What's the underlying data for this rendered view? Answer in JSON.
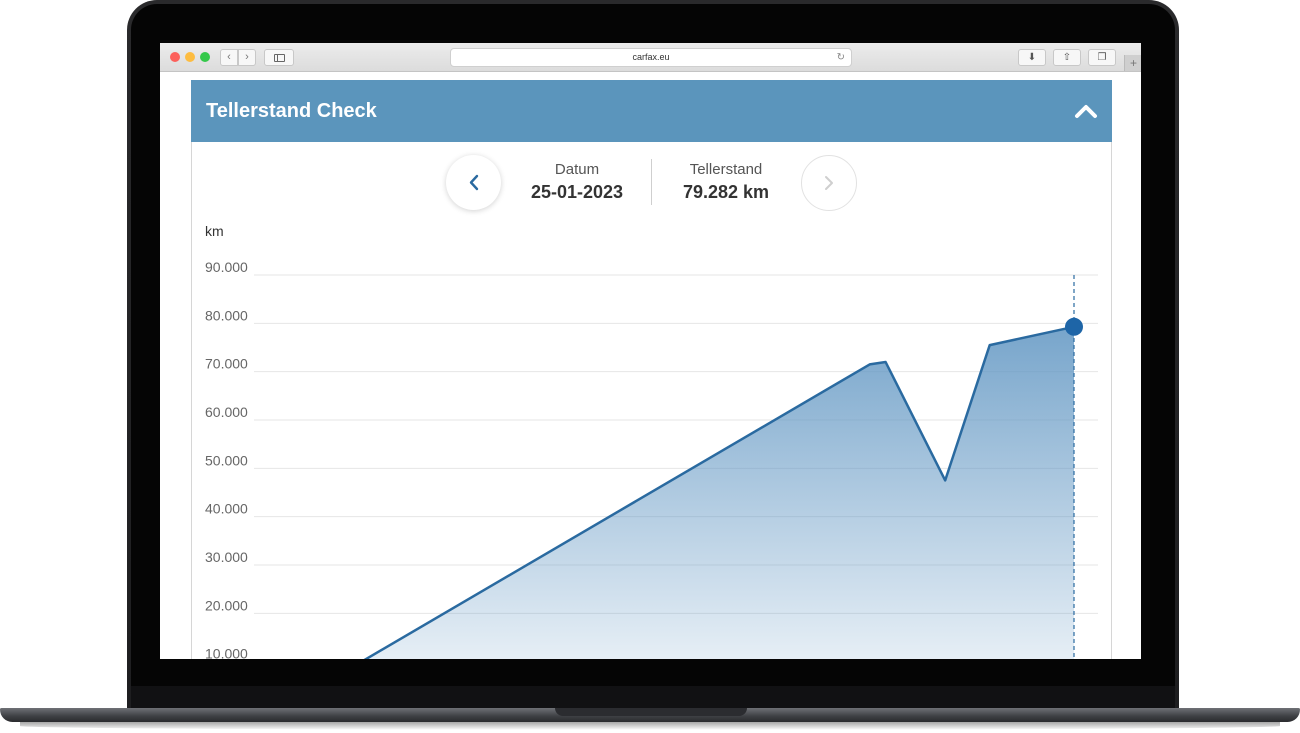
{
  "browser": {
    "url": "carfax.eu",
    "icons": [
      "close-icon",
      "minimize-icon",
      "maximize-icon",
      "back-icon",
      "forward-icon",
      "sidebar-icon",
      "reload-icon",
      "download-icon",
      "share-icon",
      "tabs-icon",
      "new-tab-icon"
    ]
  },
  "card": {
    "title": "Tellerstand Check",
    "collapse_icon": "chevron-up-icon"
  },
  "reading": {
    "date_label": "Datum",
    "date_value": "25-01-2023",
    "odometer_label": "Tellerstand",
    "odometer_value": "79.282 km",
    "prev_icon": "chevron-left-icon",
    "next_icon": "chevron-right-icon"
  },
  "colors": {
    "header": "#5b95bc",
    "line": "#2a6aa0",
    "marker": "#1e65a7"
  },
  "chart_data": {
    "type": "area",
    "ylabel": "km",
    "y_ticks": [
      "90.000",
      "80.000",
      "70.000",
      "60.000",
      "50.000",
      "40.000",
      "30.000",
      "20.000",
      "10.000"
    ],
    "ylim": [
      0,
      90000
    ],
    "grid": true,
    "series": [
      {
        "points": [
          {
            "t": 0.0,
            "y": 0
          },
          {
            "t": 0.743,
            "y": 71500
          },
          {
            "t": 0.763,
            "y": 72000
          },
          {
            "t": 0.838,
            "y": 47500
          },
          {
            "t": 0.894,
            "y": 75500
          },
          {
            "t": 1.0,
            "y": 79282
          }
        ]
      }
    ],
    "selected_point": {
      "date": "25-01-2023",
      "y": 79282
    }
  }
}
